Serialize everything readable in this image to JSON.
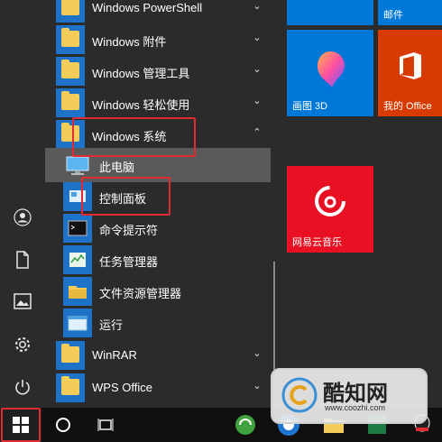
{
  "rail": {
    "icons": [
      "user-icon",
      "document-icon",
      "pictures-icon",
      "settings-icon",
      "power-icon"
    ]
  },
  "app_list": [
    {
      "label": "Windows PowerShell",
      "type": "folder",
      "chevron": "down"
    },
    {
      "label": "Windows 附件",
      "type": "folder",
      "chevron": "down"
    },
    {
      "label": "Windows 管理工具",
      "type": "folder",
      "chevron": "down"
    },
    {
      "label": "Windows 轻松使用",
      "type": "folder",
      "chevron": "down"
    },
    {
      "label": "Windows 系统",
      "type": "folder",
      "chevron": "up",
      "expanded": true
    },
    {
      "label": "此电脑",
      "type": "app",
      "icon": "computer-icon",
      "highlighted": true
    },
    {
      "label": "控制面板",
      "type": "app",
      "icon": "control-panel-icon"
    },
    {
      "label": "命令提示符",
      "type": "app",
      "icon": "command-prompt-icon"
    },
    {
      "label": "任务管理器",
      "type": "app",
      "icon": "task-manager-icon"
    },
    {
      "label": "文件资源管理器",
      "type": "app",
      "icon": "file-explorer-icon"
    },
    {
      "label": "运行",
      "type": "app",
      "icon": "run-icon"
    },
    {
      "label": "WinRAR",
      "type": "folder",
      "chevron": "down"
    },
    {
      "label": "WPS Office",
      "type": "folder",
      "chevron": "down"
    }
  ],
  "tiles": {
    "mail": {
      "label": "邮件",
      "color": "#0078d7"
    },
    "paint3d": {
      "label": "画图 3D",
      "color": "#0078d7"
    },
    "office": {
      "label": "我的 Office",
      "color": "#d83b01"
    },
    "netease": {
      "label": "网易云音乐",
      "color": "#e81123"
    }
  },
  "taskbar": {
    "icons": [
      "windows-start-icon",
      "cortana-search-icon",
      "task-view-icon",
      "green-app-icon",
      "blue-browser-icon",
      "folder-icon",
      "excel-icon",
      "qq-icon"
    ]
  },
  "watermark": {
    "title": "酷知网",
    "url": "www.coozhi.com"
  },
  "colors": {
    "accent": "#0078d7",
    "highlight_box": "#e02b33"
  }
}
